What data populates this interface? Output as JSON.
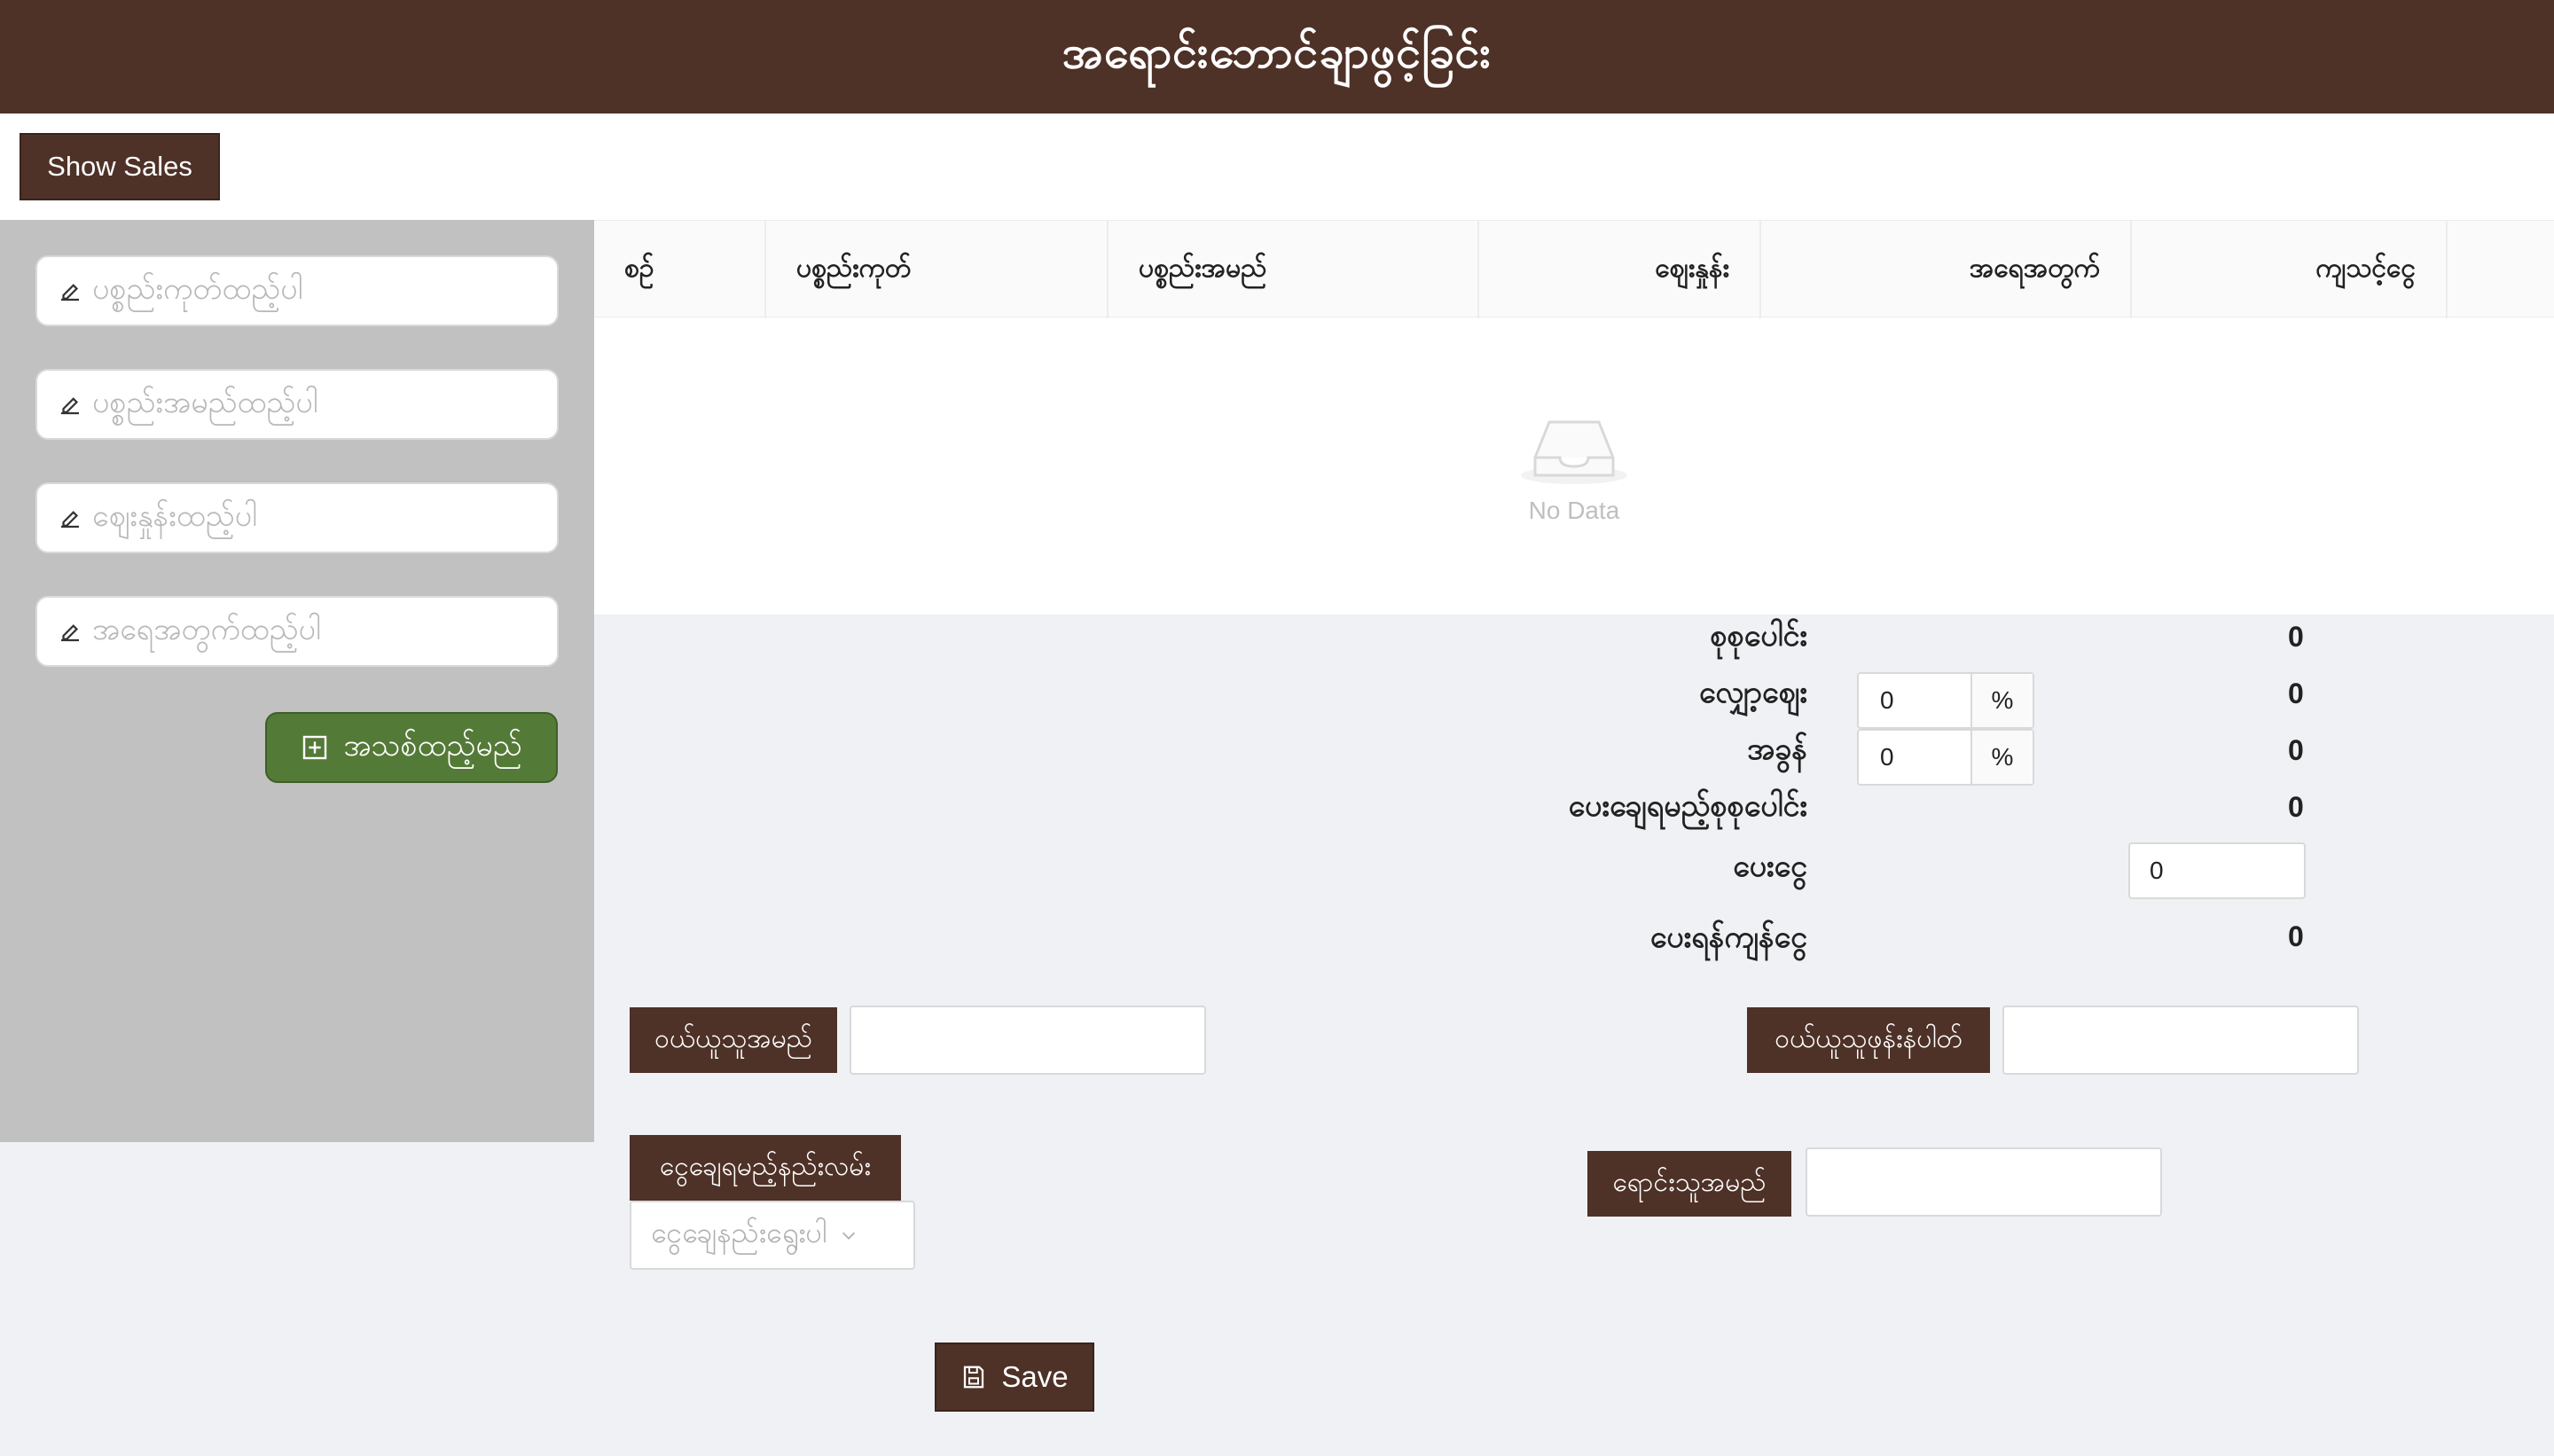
{
  "header": {
    "title": "အရောင်းဘောင်ချာဖွင့်ခြင်း"
  },
  "topbar": {
    "show_sales_label": "Show Sales"
  },
  "sidebar": {
    "inputs": [
      {
        "placeholder": "ပစ္စည်းကုတ်ထည့်ပါ"
      },
      {
        "placeholder": "ပစ္စည်းအမည်ထည့်ပါ"
      },
      {
        "placeholder": "ဈေးနှုန်းထည့်ပါ"
      },
      {
        "placeholder": "အရေအတွက်ထည့်ပါ"
      }
    ],
    "add_button_label": "အသစ်ထည့်မည်"
  },
  "table": {
    "columns": [
      "စဥ်",
      "ပစ္စည်းကုတ်",
      "ပစ္စည်းအမည်",
      "ဈေးနှုန်း",
      "အရေအတွက်",
      "ကျသင့်ငွေ"
    ],
    "empty_text": "No Data"
  },
  "summary": {
    "total_label": "စုစုပေါင်း",
    "total_value": "0",
    "discount_label": "လျှော့ဈေး",
    "discount_input": "0",
    "discount_unit": "%",
    "discount_value": "0",
    "tax_label": "အခွန်",
    "tax_input": "0",
    "tax_unit": "%",
    "tax_value": "0",
    "grand_total_label": "ပေးချေရမည့်စုစုပေါင်း",
    "grand_total_value": "0",
    "paid_label": "ပေးငွေ",
    "paid_input": "0",
    "change_label": "ပေးရန်ကျန်ငွေ",
    "change_value": "0"
  },
  "form": {
    "customer_name_label": "ဝယ်ယူသူအမည်",
    "customer_phone_label": "ဝယ်ယူသူဖုန်းနံပါတ်",
    "payment_method_label": "ငွေချေရမည့်နည်းလမ်း",
    "payment_method_placeholder": "ငွေချေနည်းရွေးပါ",
    "seller_name_label": "ရောင်းသူအမည်",
    "save_label": "Save"
  }
}
